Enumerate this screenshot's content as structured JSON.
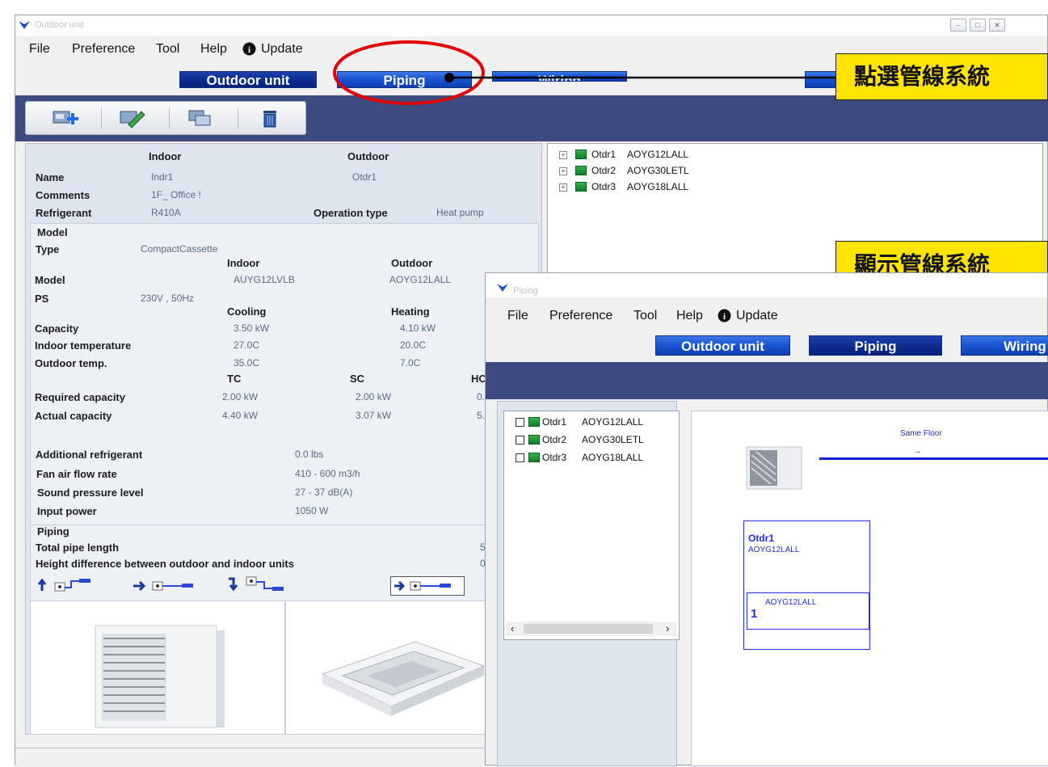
{
  "main_window": {
    "title": "Outdoor unit",
    "menu": [
      "File",
      "Preference",
      "Tool",
      "Help",
      "Update"
    ],
    "tabs": {
      "outdoor": "Outdoor unit",
      "piping": "Piping",
      "wiring": "Wiring"
    },
    "toolbar_icons": [
      "add-unit-icon",
      "edit-icon",
      "copy-icon",
      "delete-icon"
    ],
    "properties": {
      "col_indoor": "Indoor",
      "col_outdoor": "Outdoor",
      "name_label": "Name",
      "name_indoor": "Indr1",
      "name_outdoor": "Otdr1",
      "comments_label": "Comments",
      "comments_value": "1F_ Office !",
      "refrigerant_label": "Refrigerant",
      "refrigerant_value": "R410A",
      "operation_type_label": "Operation type",
      "operation_type_value": "Heat pump",
      "model_section": "Model",
      "type_label": "Type",
      "type_value": "CompactCassette",
      "model_indoor_hdr": "Indoor",
      "model_outdoor_hdr": "Outdoor",
      "model_label": "Model",
      "model_indoor": "AUYG12LVLB",
      "model_outdoor": "AOYG12LALL",
      "ps_label": "PS",
      "ps_value": "230V , 50Hz",
      "cooling_hdr": "Cooling",
      "heating_hdr": "Heating",
      "capacity_label": "Capacity",
      "capacity_cooling": "3.50 kW",
      "capacity_heating": "4.10 kW",
      "indoor_temp_label": "Indoor temperature",
      "indoor_temp_cooling": "27.0C",
      "indoor_temp_heating": "20.0C",
      "outdoor_temp_label": "Outdoor temp.",
      "outdoor_temp_cooling": "35.0C",
      "outdoor_temp_heating": "7.0C",
      "tc_hdr": "TC",
      "sc_hdr": "SC",
      "hc_hdr": "HC",
      "required_capacity_label": "Required capacity",
      "required_capacity_tc": "2.00 kW",
      "required_capacity_sc": "2.00 kW",
      "required_capacity_hc": "0.",
      "actual_capacity_label": "Actual capacity",
      "actual_capacity_tc": "4.40 kW",
      "actual_capacity_sc": "3.07 kW",
      "actual_capacity_hc": "5.",
      "additional_refrigerant_label": "Additional refrigerant",
      "additional_refrigerant_value": "0.0 lbs",
      "fan_air_flow_label": "Fan air flow rate",
      "fan_air_flow_value": "410 - 600 m3/h",
      "sound_pressure_label": "Sound pressure level",
      "sound_pressure_value": "27 - 37 dB(A)",
      "input_power_label": "Input power",
      "input_power_value": "1050 W",
      "piping_section": "Piping",
      "total_pipe_label": "Total pipe length",
      "total_pipe_value": "5",
      "height_diff_label": "Height difference between outdoor and indoor units",
      "height_diff_value": "0"
    },
    "tree": [
      {
        "id": "Otdr1",
        "model": "AOYG12LALL"
      },
      {
        "id": "Otdr2",
        "model": "AOYG30LETL"
      },
      {
        "id": "Otdr3",
        "model": "AOYG18LALL"
      }
    ]
  },
  "callouts": {
    "top": "點選管線系統",
    "middle": "顯示管線系統"
  },
  "piping_window": {
    "title": "Piping",
    "menu": [
      "File",
      "Preference",
      "Tool",
      "Help",
      "Update"
    ],
    "tabs": {
      "outdoor": "Outdoor unit",
      "piping": "Piping",
      "wiring": "Wiring"
    },
    "tree": [
      {
        "id": "Otdr1",
        "model": "AOYG12LALL"
      },
      {
        "id": "Otdr2",
        "model": "AOYG30LETL"
      },
      {
        "id": "Otdr3",
        "model": "AOYG18LALL"
      }
    ],
    "diagram": {
      "floor_label": "Same Floor",
      "arrow": "→",
      "unit_name": "Otdr1",
      "unit_model": "AOYG12LALL",
      "sub_model": "AOYG12LALL",
      "sub_index": "1"
    }
  },
  "colors": {
    "tab_blue": "#1753d1",
    "dark_bar": "#3e4b80",
    "callout_yellow": "#ffe400",
    "highlight_circle": "#e00000",
    "diagram_blue": "#2630d8"
  }
}
